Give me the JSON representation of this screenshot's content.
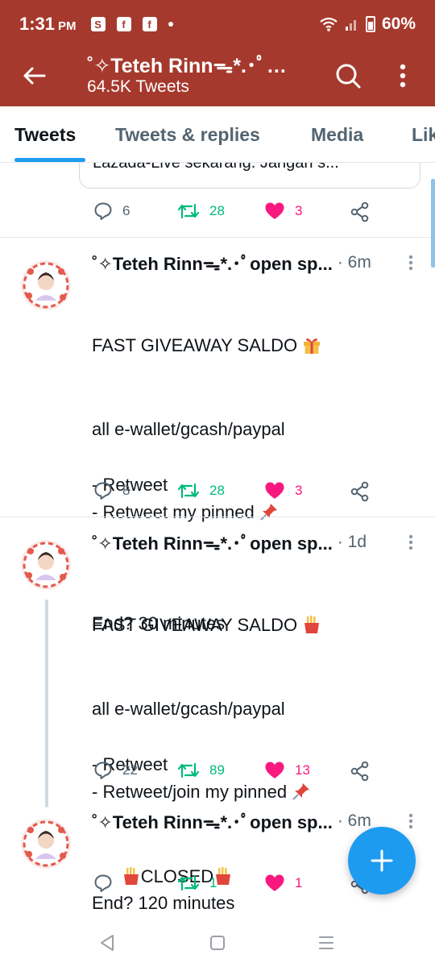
{
  "status_bar": {
    "time": "1:31",
    "meridiem": "PM",
    "battery": "60%"
  },
  "header": {
    "title": "˚✧Teteh Rinnᯓ*.･ﾟ…",
    "subtitle": "64.5K Tweets"
  },
  "tabs": [
    {
      "label": "Tweets",
      "active": true
    },
    {
      "label": "Tweets & replies",
      "active": false
    },
    {
      "label": "Media",
      "active": false
    },
    {
      "label": "Lik",
      "active": false
    }
  ],
  "top_fragment": {
    "quote_text": "Lazada-Live sekarang. Jangan s...",
    "replies": "6",
    "retweets": "28",
    "likes": "3"
  },
  "tweets": [
    {
      "author": "˚✧Teteh Rinnᯓ*.･ﾟopen sp...",
      "time": "· 6m",
      "title_line": "FAST GIVEAWAY SALDO",
      "body": "all e-wallet/gcash/paypal\n\n- Retweet\n- Retweet my pinned",
      "end_line": "End? 30 minutes",
      "replies": "8",
      "retweets": "28",
      "likes": "3"
    },
    {
      "author": "˚✧Teteh Rinnᯓ*.･ﾟopen sp...",
      "time": "· 1d",
      "title_line": "FAST GIVEAWAY SALDO",
      "body": "all e-wallet/gcash/paypal\n\n- Retweet\n- Retweet/join my pinned",
      "end_line": "End? 120 minutes",
      "replies": "22",
      "retweets": "89",
      "likes": "13"
    },
    {
      "author": "˚✧Teteh Rinnᯓ*.･ﾟopen sp...",
      "time": "· 6m",
      "body": "CLOSED",
      "replies": "",
      "retweets": "1",
      "likes": "1"
    }
  ],
  "colors": {
    "brand_header": "#a6392d",
    "accent": "#1d9bf0",
    "retweet": "#00ba7c",
    "like": "#f91880",
    "muted": "#536471"
  },
  "icons": {
    "back": "arrow-left-icon",
    "search": "search-icon",
    "more": "more-vertical-icon",
    "reply": "reply-icon",
    "retweet": "retweet-icon",
    "like": "heart-icon",
    "share": "share-icon",
    "compose": "plus-icon",
    "gift": "gift-emoji-icon",
    "pin": "pushpin-emoji-icon",
    "fries": "fries-emoji-icon"
  }
}
